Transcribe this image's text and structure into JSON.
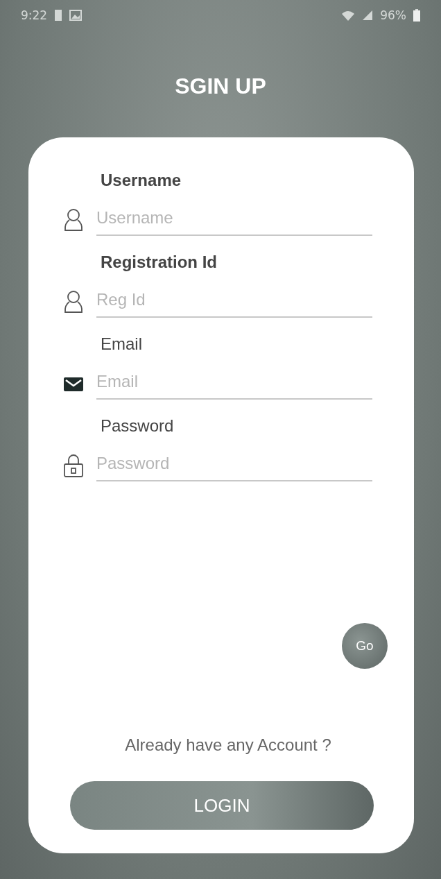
{
  "status_bar": {
    "time": "9:22",
    "battery": "96%"
  },
  "title": "SGIN UP",
  "fields": [
    {
      "label": "Username",
      "placeholder": "Username",
      "kind": "user"
    },
    {
      "label": "Registration Id",
      "placeholder": "Reg Id",
      "kind": "user"
    },
    {
      "label": "Email",
      "placeholder": "Email",
      "kind": "mail"
    },
    {
      "label": "Password",
      "placeholder": "Password",
      "kind": "lock"
    }
  ],
  "go_button": "Go",
  "login_prompt": "Already have any Account ?",
  "login_button": "LOGIN"
}
